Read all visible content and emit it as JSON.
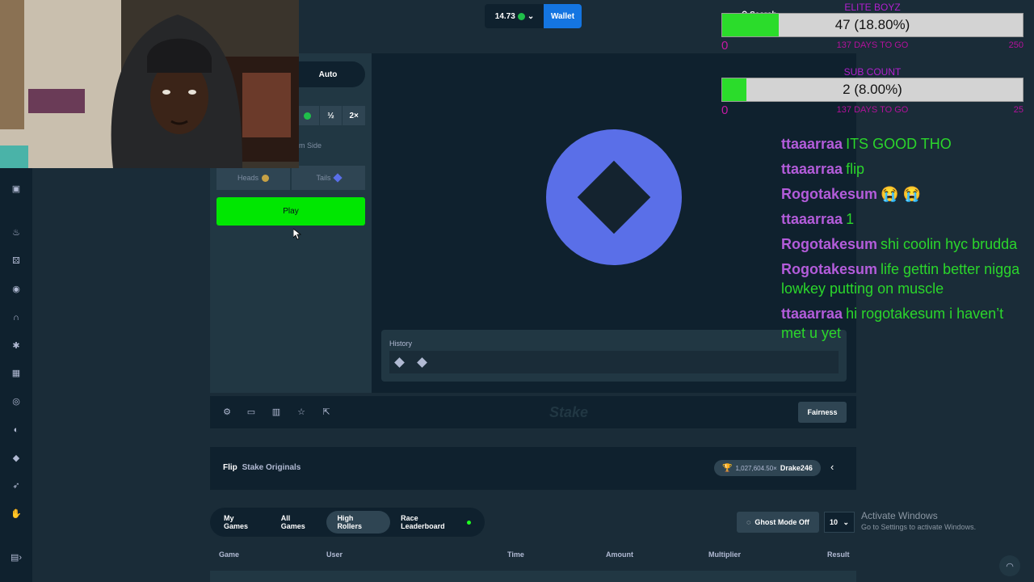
{
  "topbar": {
    "balance": "14.73",
    "wallet_label": "Wallet",
    "search_label": "Search"
  },
  "game": {
    "tab_auto": "Auto",
    "half_label": "½",
    "double_label": "2×",
    "side_label": "m Side",
    "heads_label": "Heads",
    "tails_label": "Tails",
    "play_label": "Play",
    "history_label": "History",
    "history_results": [
      "tails",
      "tails"
    ]
  },
  "toolbar": {
    "fairness_label": "Fairness",
    "logo_text": "Stake"
  },
  "info": {
    "game_name": "Flip",
    "provider": "Stake Originals",
    "record_multiplier": "1,027,604.50×",
    "record_user": "Drake246"
  },
  "bets": {
    "tabs": [
      {
        "label": "My Games",
        "active": false
      },
      {
        "label": "All Games",
        "active": false
      },
      {
        "label": "High Rollers",
        "active": true
      },
      {
        "label": "Race Leaderboard",
        "active": false
      }
    ],
    "ghost_label": "Ghost Mode Off",
    "page_size": "10",
    "columns": [
      "Game",
      "User",
      "Time",
      "Amount",
      "Multiplier",
      "Result"
    ]
  },
  "os": {
    "activate_title": "Activate Windows",
    "activate_sub": "Go to Settings to activate Windows."
  },
  "overlays": {
    "goal1": {
      "title": "ELITE BOYZ",
      "value_text": "47 (18.80%)",
      "fraction": 0.188,
      "left": "0",
      "days": "137 DAYS TO GO",
      "right": "250"
    },
    "goal2": {
      "title": "SUB COUNT",
      "value_text": "2 (8.00%)",
      "fraction": 0.08,
      "left": "0",
      "days": "137 DAYS TO GO",
      "right": "25"
    }
  },
  "chat": [
    {
      "user": "ttaaarraa",
      "text": "ITS GOOD THO"
    },
    {
      "user": "ttaaarraa",
      "text": "flip"
    },
    {
      "user": "Rogotakesum",
      "text": "😭 😭"
    },
    {
      "user": "ttaaarraa",
      "text": "1"
    },
    {
      "user": "Rogotakesum",
      "text": "shi coolin hyc brudda"
    },
    {
      "user": "Rogotakesum",
      "text": "life gettin better nigga lowkey putting on muscle"
    },
    {
      "user": "ttaaarraa",
      "text": "hi rogotakesum i haven’t met u yet"
    }
  ],
  "colors": {
    "accent_green": "#00e701",
    "wallet_blue": "#1475e1",
    "coin_blue": "#5a6fe8",
    "bg_dark": "#0f212e"
  }
}
